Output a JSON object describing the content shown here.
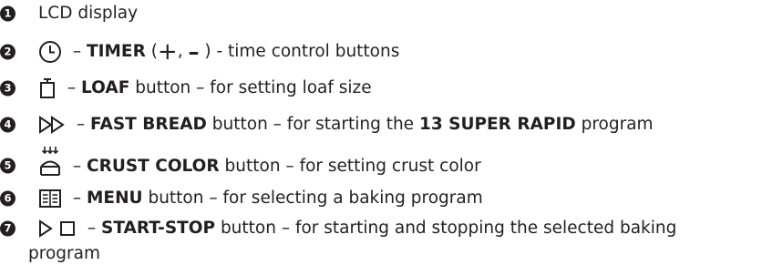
{
  "items": [
    {
      "number": "1",
      "text": "LCD display"
    },
    {
      "number": "2",
      "icon": "clock-icon",
      "sep": " – ",
      "label": "TIMER",
      "rest": " (",
      "plus": "+",
      "comma": ", ",
      "minus": "–",
      "tail": " ) - time control buttons"
    },
    {
      "number": "3",
      "icon": "loaf-icon",
      "sep": " – ",
      "label": "LOAF",
      "rest": " button – for setting loaf size"
    },
    {
      "number": "4",
      "icon": "fast-forward-icon",
      "sep": " – ",
      "label": "FAST BREAD",
      "rest": " button – for starting the ",
      "highlight": "13 SUPER RAPID",
      "tail": " program"
    },
    {
      "number": "5",
      "icon": "crust-color-icon",
      "sep": " – ",
      "label": "CRUST COLOR",
      "rest": " button – for setting crust color"
    },
    {
      "number": "6",
      "icon": "menu-icon",
      "sep": " – ",
      "label": "MENU",
      "rest": " button – for selecting a baking program"
    },
    {
      "number": "7",
      "icon": "start-stop-icon",
      "sep": " – ",
      "label": "START-STOP",
      "rest": " button – for starting and stopping the selected baking",
      "continuation": "program"
    }
  ]
}
